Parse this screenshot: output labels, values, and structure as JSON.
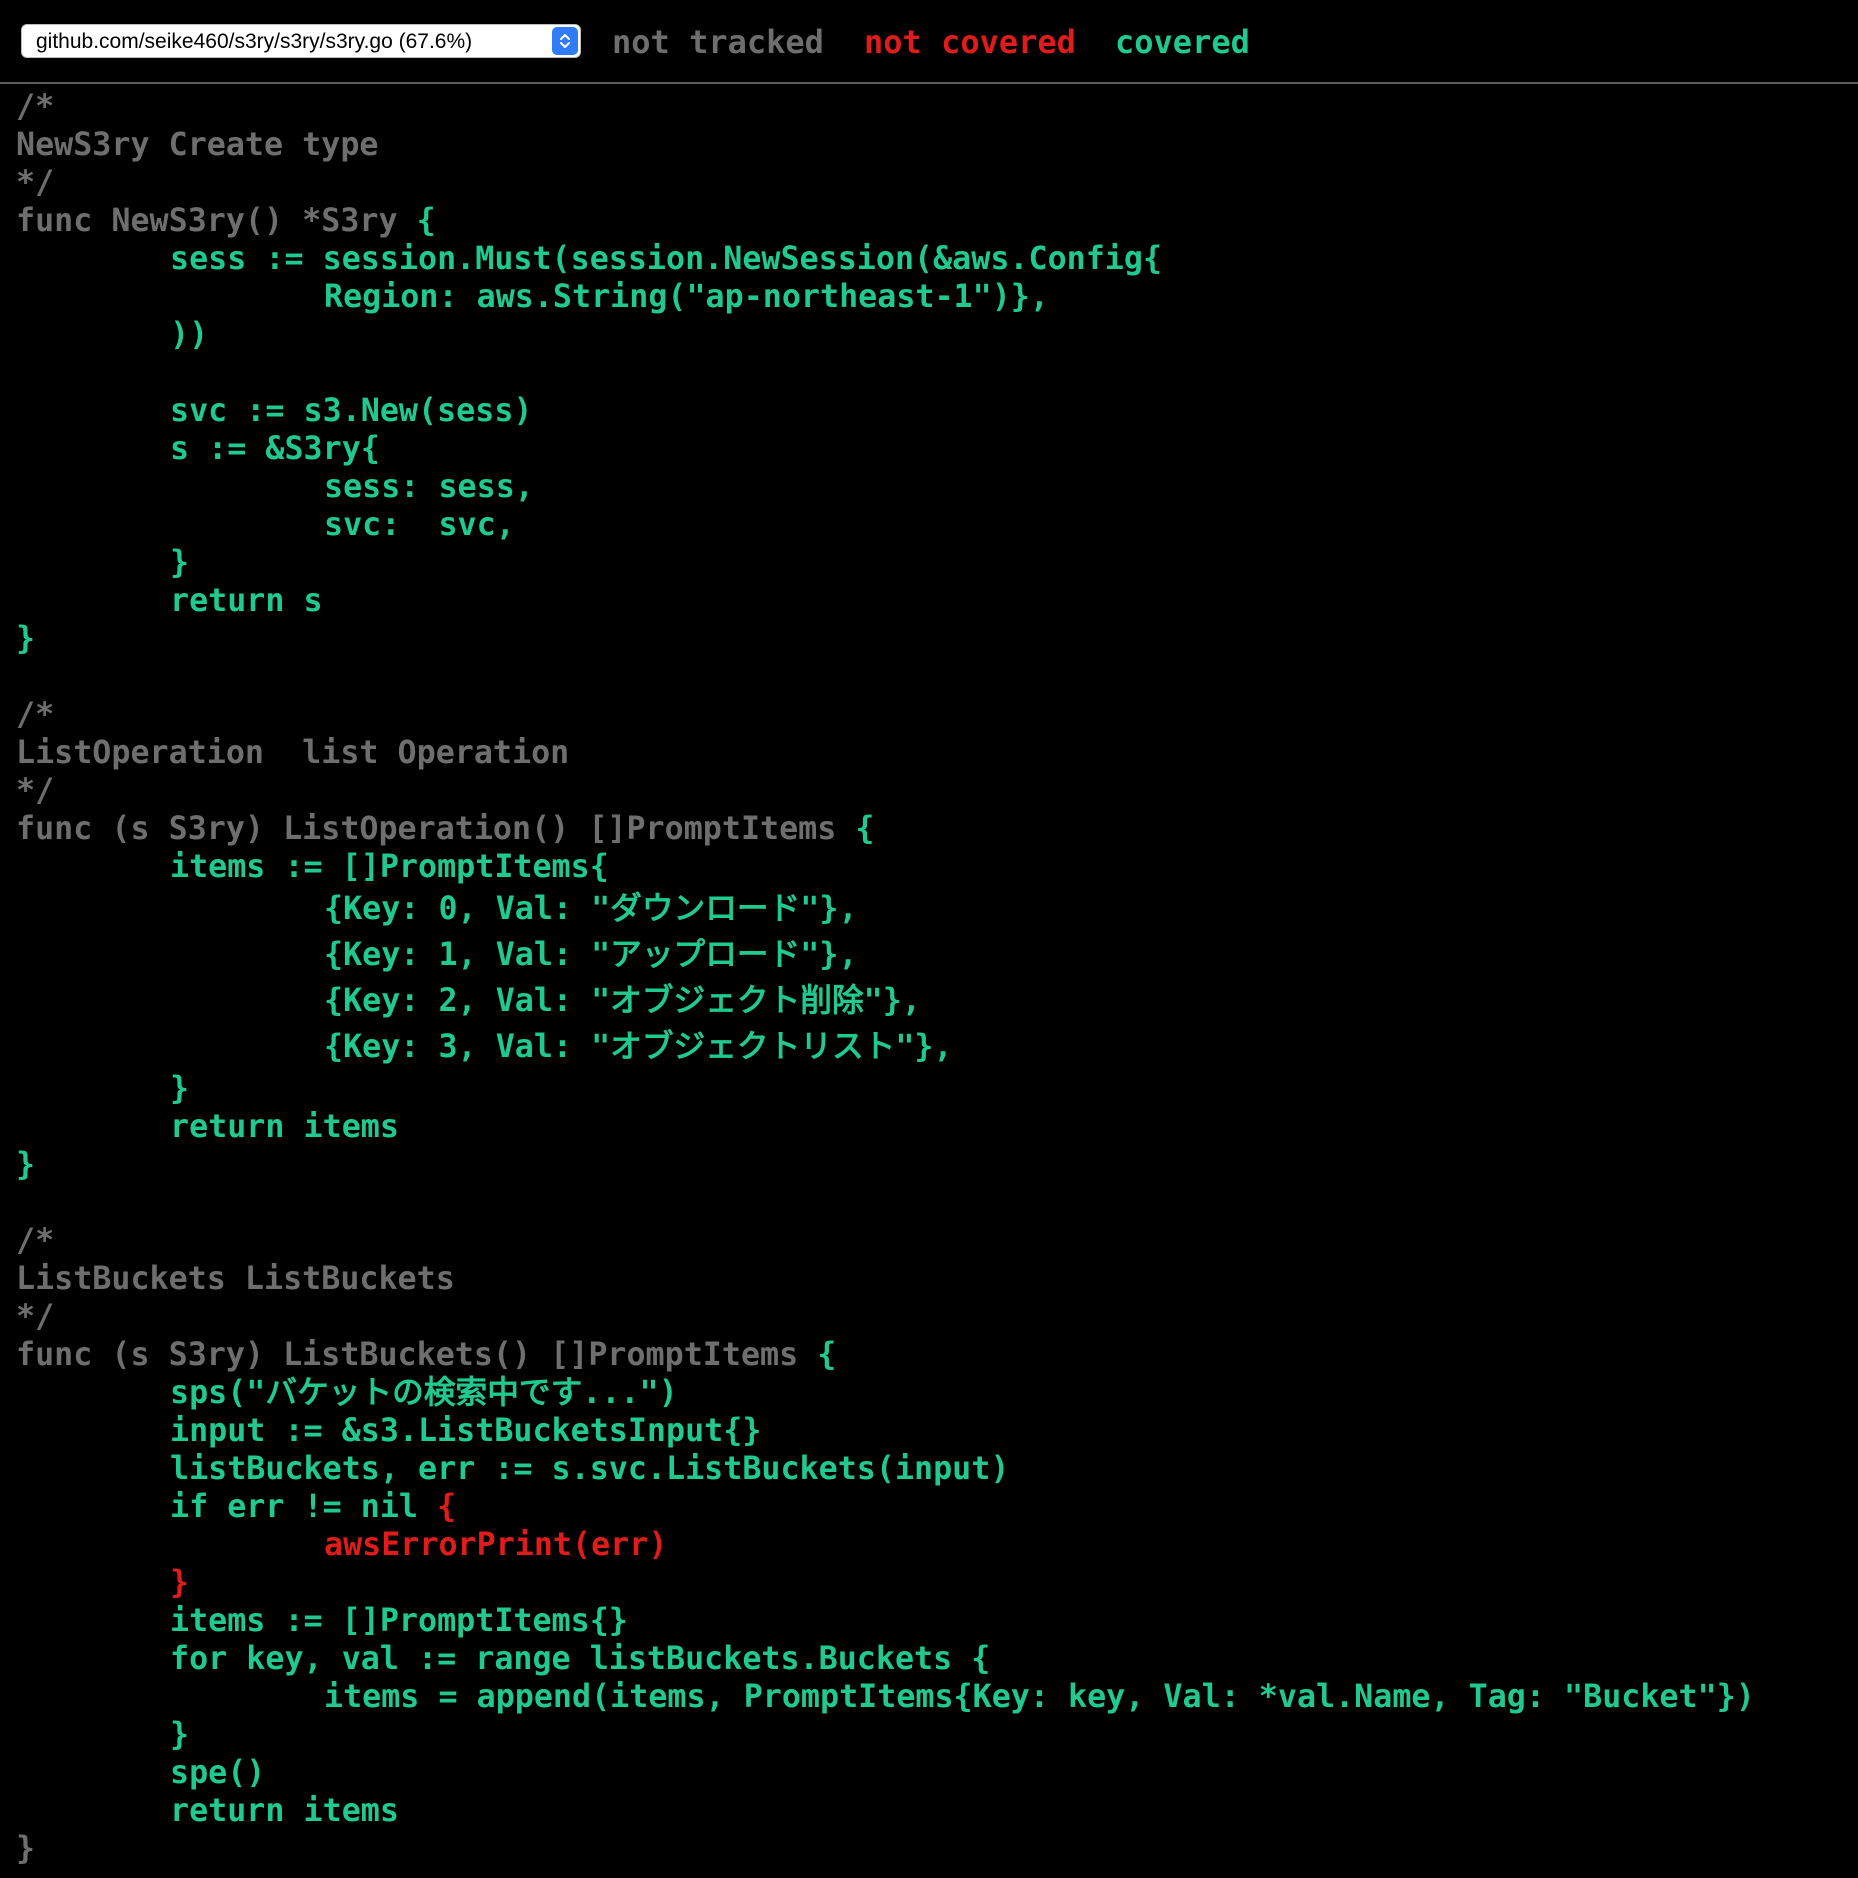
{
  "header": {
    "file_select": {
      "value": "github.com/seike460/s3ry/s3ry/s3ry.go (67.6%)"
    },
    "legend": {
      "not_tracked": "not tracked",
      "not_covered": "not covered",
      "covered": "covered"
    }
  },
  "colors": {
    "background": "#000000",
    "not_tracked": "#6e6e6e",
    "not_covered": "#e01b1b",
    "covered": "#1fc98f",
    "select_arrow": "#2f7cf6"
  },
  "code": {
    "lines": [
      {
        "segments": [
          {
            "text": "/*",
            "status": "nt"
          }
        ]
      },
      {
        "segments": [
          {
            "text": "NewS3ry Create type",
            "status": "nt"
          }
        ]
      },
      {
        "segments": [
          {
            "text": "*/",
            "status": "nt"
          }
        ]
      },
      {
        "segments": [
          {
            "text": "func NewS3ry() *S3ry ",
            "status": "nt"
          },
          {
            "text": "{",
            "status": "cv"
          }
        ]
      },
      {
        "indent": 1,
        "segments": [
          {
            "text": "sess := session.Must(session.NewSession(&aws.Config{",
            "status": "cv"
          }
        ]
      },
      {
        "indent": 2,
        "segments": [
          {
            "text": "Region: aws.String(\"ap-northeast-1\")},",
            "status": "cv"
          }
        ]
      },
      {
        "indent": 1,
        "segments": [
          {
            "text": "))",
            "status": "cv"
          }
        ]
      },
      {
        "segments": [
          {
            "text": "",
            "status": "nt"
          }
        ]
      },
      {
        "indent": 1,
        "segments": [
          {
            "text": "svc := s3.New(sess)",
            "status": "cv"
          }
        ]
      },
      {
        "indent": 1,
        "segments": [
          {
            "text": "s := &S3ry{",
            "status": "cv"
          }
        ]
      },
      {
        "indent": 2,
        "segments": [
          {
            "text": "sess: sess,",
            "status": "cv"
          }
        ]
      },
      {
        "indent": 2,
        "segments": [
          {
            "text": "svc:  svc,",
            "status": "cv"
          }
        ]
      },
      {
        "indent": 1,
        "segments": [
          {
            "text": "}",
            "status": "cv"
          }
        ]
      },
      {
        "indent": 1,
        "segments": [
          {
            "text": "return s",
            "status": "cv"
          }
        ]
      },
      {
        "segments": [
          {
            "text": "}",
            "status": "cv"
          }
        ]
      },
      {
        "segments": [
          {
            "text": "",
            "status": "nt"
          }
        ]
      },
      {
        "segments": [
          {
            "text": "/*",
            "status": "nt"
          }
        ]
      },
      {
        "segments": [
          {
            "text": "ListOperation  list Operation",
            "status": "nt"
          }
        ]
      },
      {
        "segments": [
          {
            "text": "*/",
            "status": "nt"
          }
        ]
      },
      {
        "segments": [
          {
            "text": "func (s S3ry) ListOperation() []PromptItems ",
            "status": "nt"
          },
          {
            "text": "{",
            "status": "cv"
          }
        ]
      },
      {
        "indent": 1,
        "segments": [
          {
            "text": "items := []PromptItems{",
            "status": "cv"
          }
        ]
      },
      {
        "indent": 2,
        "tall": true,
        "segments": [
          {
            "text": "{Key: 0, Val: \"ダウンロード\"},",
            "status": "cv"
          }
        ]
      },
      {
        "indent": 2,
        "tall": true,
        "segments": [
          {
            "text": "{Key: 1, Val: \"アップロード\"},",
            "status": "cv"
          }
        ]
      },
      {
        "indent": 2,
        "tall": true,
        "segments": [
          {
            "text": "{Key: 2, Val: \"オブジェクト削除\"},",
            "status": "cv"
          }
        ]
      },
      {
        "indent": 2,
        "tall": true,
        "segments": [
          {
            "text": "{Key: 3, Val: \"オブジェクトリスト\"},",
            "status": "cv"
          }
        ]
      },
      {
        "indent": 1,
        "segments": [
          {
            "text": "}",
            "status": "cv"
          }
        ]
      },
      {
        "indent": 1,
        "segments": [
          {
            "text": "return items",
            "status": "cv"
          }
        ]
      },
      {
        "segments": [
          {
            "text": "}",
            "status": "cv"
          }
        ]
      },
      {
        "segments": [
          {
            "text": "",
            "status": "nt"
          }
        ]
      },
      {
        "segments": [
          {
            "text": "/*",
            "status": "nt"
          }
        ]
      },
      {
        "segments": [
          {
            "text": "ListBuckets ListBuckets",
            "status": "nt"
          }
        ]
      },
      {
        "segments": [
          {
            "text": "*/",
            "status": "nt"
          }
        ]
      },
      {
        "segments": [
          {
            "text": "func (s S3ry) ListBuckets() []PromptItems ",
            "status": "nt"
          },
          {
            "text": "{",
            "status": "cv"
          }
        ]
      },
      {
        "indent": 1,
        "segments": [
          {
            "text": "sps(\"バケットの検索中です...\")",
            "status": "cv"
          }
        ]
      },
      {
        "indent": 1,
        "segments": [
          {
            "text": "input := &s3.ListBucketsInput{}",
            "status": "cv"
          }
        ]
      },
      {
        "indent": 1,
        "segments": [
          {
            "text": "listBuckets, err := s.svc.ListBuckets(input)",
            "status": "cv"
          }
        ]
      },
      {
        "indent": 1,
        "segments": [
          {
            "text": "if err != nil ",
            "status": "cv"
          },
          {
            "text": "{",
            "status": "nc"
          }
        ]
      },
      {
        "indent": 2,
        "segments": [
          {
            "text": "awsErrorPrint(err)",
            "status": "nc"
          }
        ]
      },
      {
        "indent": 1,
        "segments": [
          {
            "text": "}",
            "status": "nc"
          }
        ]
      },
      {
        "indent": 1,
        "segments": [
          {
            "text": "items := []PromptItems{}",
            "status": "cv"
          }
        ]
      },
      {
        "indent": 1,
        "segments": [
          {
            "text": "for key, val := range listBuckets.Buckets {",
            "status": "cv"
          }
        ]
      },
      {
        "indent": 2,
        "segments": [
          {
            "text": "items = append(items, PromptItems{Key: key, Val: *val.Name, Tag: \"Bucket\"})",
            "status": "cv"
          }
        ]
      },
      {
        "indent": 1,
        "segments": [
          {
            "text": "}",
            "status": "cv"
          }
        ]
      },
      {
        "indent": 1,
        "segments": [
          {
            "text": "spe()",
            "status": "cv"
          }
        ]
      },
      {
        "indent": 1,
        "segments": [
          {
            "text": "return items",
            "status": "cv"
          }
        ]
      },
      {
        "segments": [
          {
            "text": "}",
            "status": "nt"
          }
        ]
      }
    ]
  }
}
